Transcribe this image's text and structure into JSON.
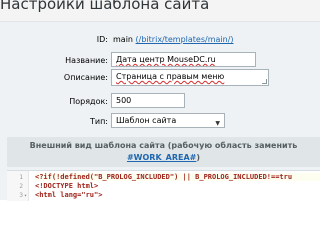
{
  "page": {
    "title": "Настройки шаблона сайта"
  },
  "form": {
    "id_label": "ID:",
    "id_value": "main",
    "id_path": "(/bitrix/templates/main/)",
    "name_label": "Название:",
    "name_value": "Дата центр MouseDC.ru",
    "desc_label": "Описание:",
    "desc_value": "Страница с правым меню",
    "order_label": "Порядок:",
    "order_value": "500",
    "type_label": "Тип:",
    "type_value": "Шаблон сайта"
  },
  "section": {
    "header_line1": "Внешний вид шаблона сайта (рабочую область заменить",
    "header_macro": "#WORK_AREA#",
    "header_close": ")"
  },
  "editor": {
    "line_numbers": [
      "1",
      "2",
      "3"
    ],
    "lines": [
      "<?if(!defined(\"B_PROLOG_INCLUDED\") || B_PROLOG_INCLUDED!==tru",
      "<!DOCTYPE html>",
      "<html lang=\"ru\">"
    ]
  },
  "colors": {
    "accent_link": "#2067b0",
    "background": "#eef2f4",
    "section_header": "#e0e6e8"
  }
}
